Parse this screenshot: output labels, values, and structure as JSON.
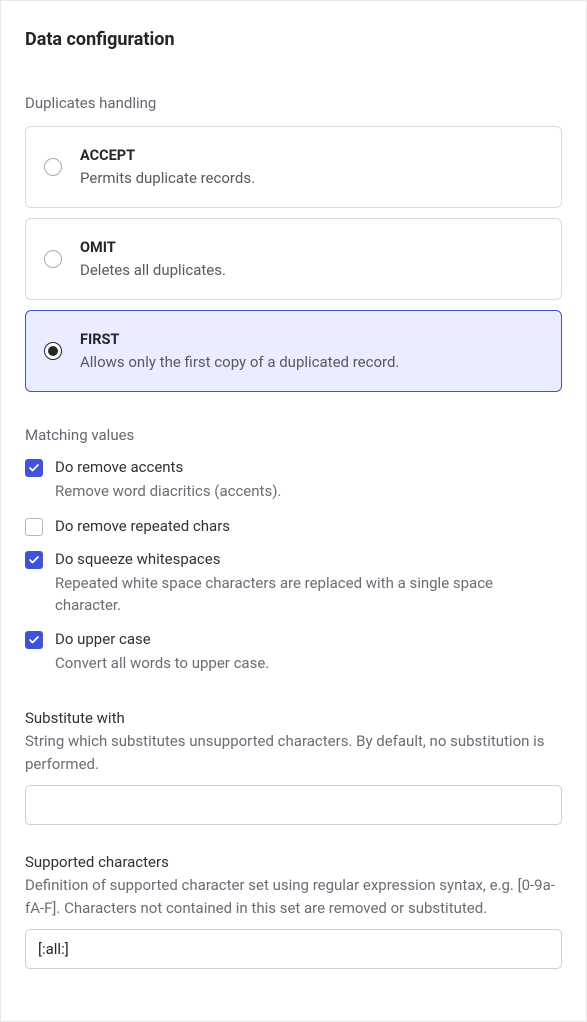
{
  "title": "Data configuration",
  "duplicates": {
    "label": "Duplicates handling",
    "options": [
      {
        "title": "ACCEPT",
        "desc": "Permits duplicate records.",
        "selected": false
      },
      {
        "title": "OMIT",
        "desc": "Deletes all duplicates.",
        "selected": false
      },
      {
        "title": "FIRST",
        "desc": "Allows only the first copy of a duplicated record.",
        "selected": true
      }
    ]
  },
  "matching": {
    "label": "Matching values",
    "options": [
      {
        "label": "Do remove accents",
        "desc": "Remove word diacritics (accents).",
        "checked": true
      },
      {
        "label": "Do remove repeated chars",
        "desc": "",
        "checked": false
      },
      {
        "label": "Do squeeze whitespaces",
        "desc": "Repeated white space characters are replaced with a single space character.",
        "checked": true
      },
      {
        "label": "Do upper case",
        "desc": "Convert all words to upper case.",
        "checked": true
      }
    ]
  },
  "substitute": {
    "label": "Substitute with",
    "desc": "String which substitutes unsupported characters. By default, no substitution is performed.",
    "value": ""
  },
  "supported": {
    "label": "Supported characters",
    "desc": "Definition of supported character set using regular expression syntax, e.g. [0-9a-fA-F]. Characters not contained in this set are removed or substituted.",
    "value": "[:all:]"
  }
}
